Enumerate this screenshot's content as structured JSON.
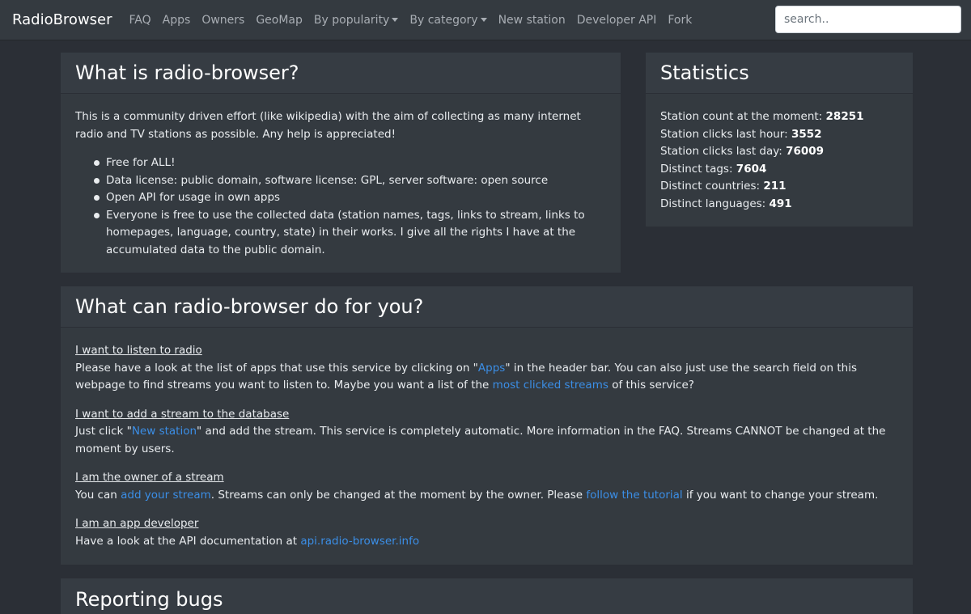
{
  "nav": {
    "brand": "RadioBrowser",
    "items": [
      "FAQ",
      "Apps",
      "Owners",
      "GeoMap",
      "By popularity",
      "By category",
      "New station",
      "Developer API",
      "Fork"
    ],
    "search_placeholder": "search.."
  },
  "about": {
    "title": "What is radio-browser?",
    "intro": "This is a community driven effort (like wikipedia) with the aim of collecting as many internet radio and TV stations as possible. Any help is appreciated!",
    "bullets": [
      "Free for ALL!",
      "Data license: public domain, software license: GPL, server software: open source",
      "Open API for usage in own apps",
      "Everyone is free to use the collected data (station names, tags, links to stream, links to homepages, language, country, state) in their works. I give all the rights I have at the accumulated data to the public domain."
    ]
  },
  "stats": {
    "title": "Statistics",
    "rows": [
      {
        "label": "Station count at the moment: ",
        "value": "28251"
      },
      {
        "label": "Station clicks last hour: ",
        "value": "3552"
      },
      {
        "label": "Station clicks last day: ",
        "value": "76009"
      },
      {
        "label": "Distinct tags: ",
        "value": "7604"
      },
      {
        "label": "Distinct countries: ",
        "value": "211"
      },
      {
        "label": "Distinct languages: ",
        "value": "491"
      }
    ]
  },
  "help": {
    "title": "What can radio-browser do for you?",
    "listen": {
      "heading": "I want to listen to radio",
      "t1": "Please have a look at the list of apps that use this service by clicking on \"",
      "link1": "Apps",
      "t2": "\" in the header bar. You can also just use the search field on this webpage to find streams you want to listen to. Maybe you want a list of the ",
      "link2": "most clicked streams",
      "t3": " of this service?"
    },
    "add": {
      "heading": "I want to add a stream to the database",
      "t1": "Just click \"",
      "link1": "New station",
      "t2": "\" and add the stream. This service is completely automatic. More information in the FAQ. Streams CANNOT be changed at the moment by users."
    },
    "owner": {
      "heading": "I am the owner of a stream",
      "t1": "You can ",
      "link1": "add your stream",
      "t2": ". Streams can only be changed at the moment by the owner. Please ",
      "link2": "follow the tutorial",
      "t3": " if you want to change your stream."
    },
    "dev": {
      "heading": "I am an app developer",
      "t1": "Have a look at the API documentation at ",
      "link1": "api.radio-browser.info"
    }
  },
  "bugs": {
    "title": "Reporting bugs"
  }
}
